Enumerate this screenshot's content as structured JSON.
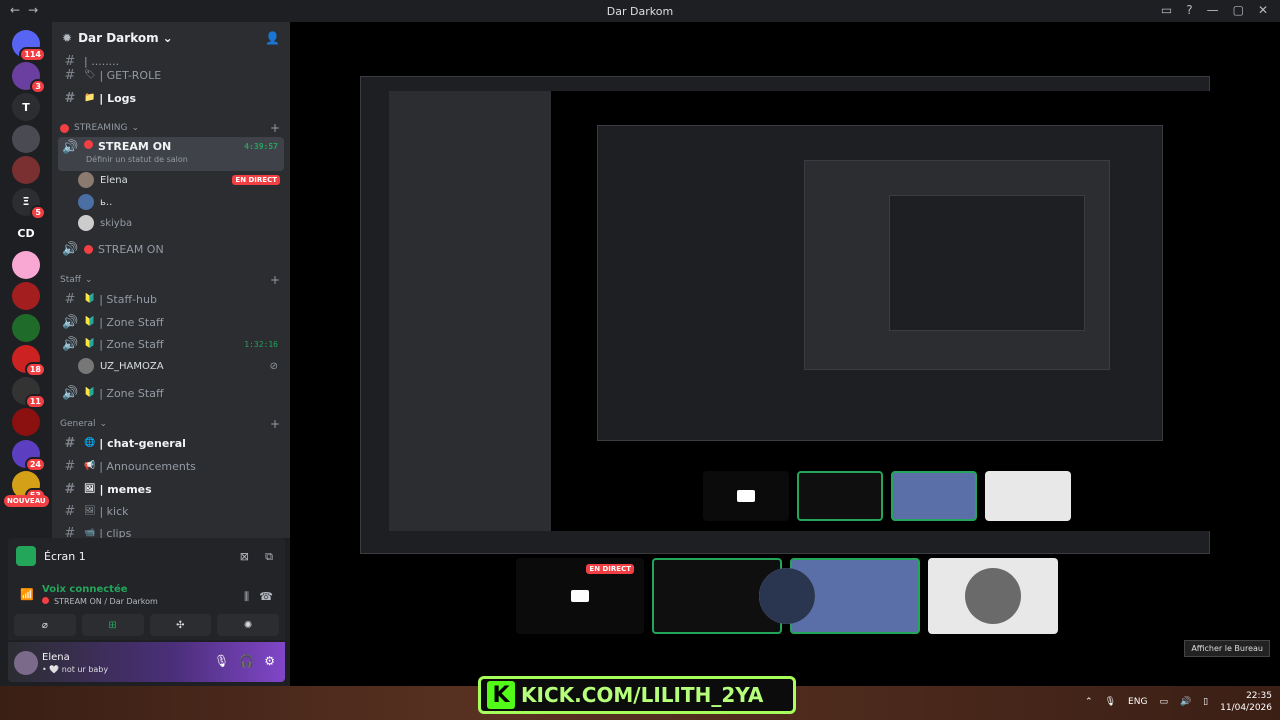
{
  "titlebar": {
    "title": "Dar Darkom",
    "back": "←",
    "forward": "→"
  },
  "guilds": [
    {
      "badge": "114",
      "color": "#5865f2"
    },
    {
      "badge": "3",
      "color": "#6b3fa0"
    },
    {
      "badge": "",
      "color": "#2b2d31",
      "label": "T"
    },
    {
      "badge": "",
      "color": "#4a4a52"
    },
    {
      "badge": "",
      "color": "#7a3030"
    },
    {
      "badge": "5",
      "color": "#2b2d31",
      "label": "Ξ"
    },
    {
      "badge": "",
      "color": "#1e1f22",
      "label": "CD"
    },
    {
      "badge": "",
      "color": "#f9a8d4"
    },
    {
      "badge": "",
      "color": "#a31f1f"
    },
    {
      "badge": "",
      "color": "#1f6b2a"
    },
    {
      "badge": "18",
      "color": "#c22"
    },
    {
      "badge": "11",
      "color": "#333"
    },
    {
      "badge": "",
      "color": "#8b1010"
    },
    {
      "badge": "24",
      "color": "#5b3fc0"
    },
    {
      "badge": "53",
      "color": "#d4a017"
    }
  ],
  "new_badge": "NOUVEAU",
  "server": {
    "name": "Dar Darkom"
  },
  "channels": {
    "top_partial": "| ........",
    "get_role": "| GET-ROLE",
    "logs": "| Logs",
    "streaming_cat": "STREAMING",
    "stream_on": "STREAM ON",
    "stream_timer": "4:39:57",
    "status_hint": "Définir un statut de salon",
    "members": [
      {
        "name": "Elena",
        "live": "EN DIRECT"
      },
      {
        "name": "ь..",
        "live": ""
      },
      {
        "name": "skiyba",
        "live": ""
      }
    ],
    "stream_on_2": "STREAM ON",
    "staff_cat": "Staff",
    "staff_hub": "| Staff-hub",
    "zone_staff_1": "| Zone Staff",
    "zone_staff_2": "| Zone Staff",
    "zone_staff_timer": "1:32:16",
    "uz": "UZ_HAMOZA",
    "zone_staff_3": "| Zone Staff",
    "general_cat": "General",
    "chat_general": "| chat-general",
    "announcements": "| Announcements",
    "memes": "| memes",
    "kick": "| kick",
    "clips": "| clips"
  },
  "voice": {
    "screen": "Écran 1",
    "connected": "Voix connectée",
    "location": "STREAM ON / Dar Darkom"
  },
  "user": {
    "name": "Elena",
    "status": "• 🤍 not ur baby"
  },
  "stage": {
    "live": "EN DIRECT",
    "afficher": "Afficher le Bureau"
  },
  "overlay": {
    "kick": "KICK.COM/LILITH_2YA"
  },
  "tray": {
    "lang": "ENG",
    "time": "22:35",
    "date": "11/04/2026"
  }
}
